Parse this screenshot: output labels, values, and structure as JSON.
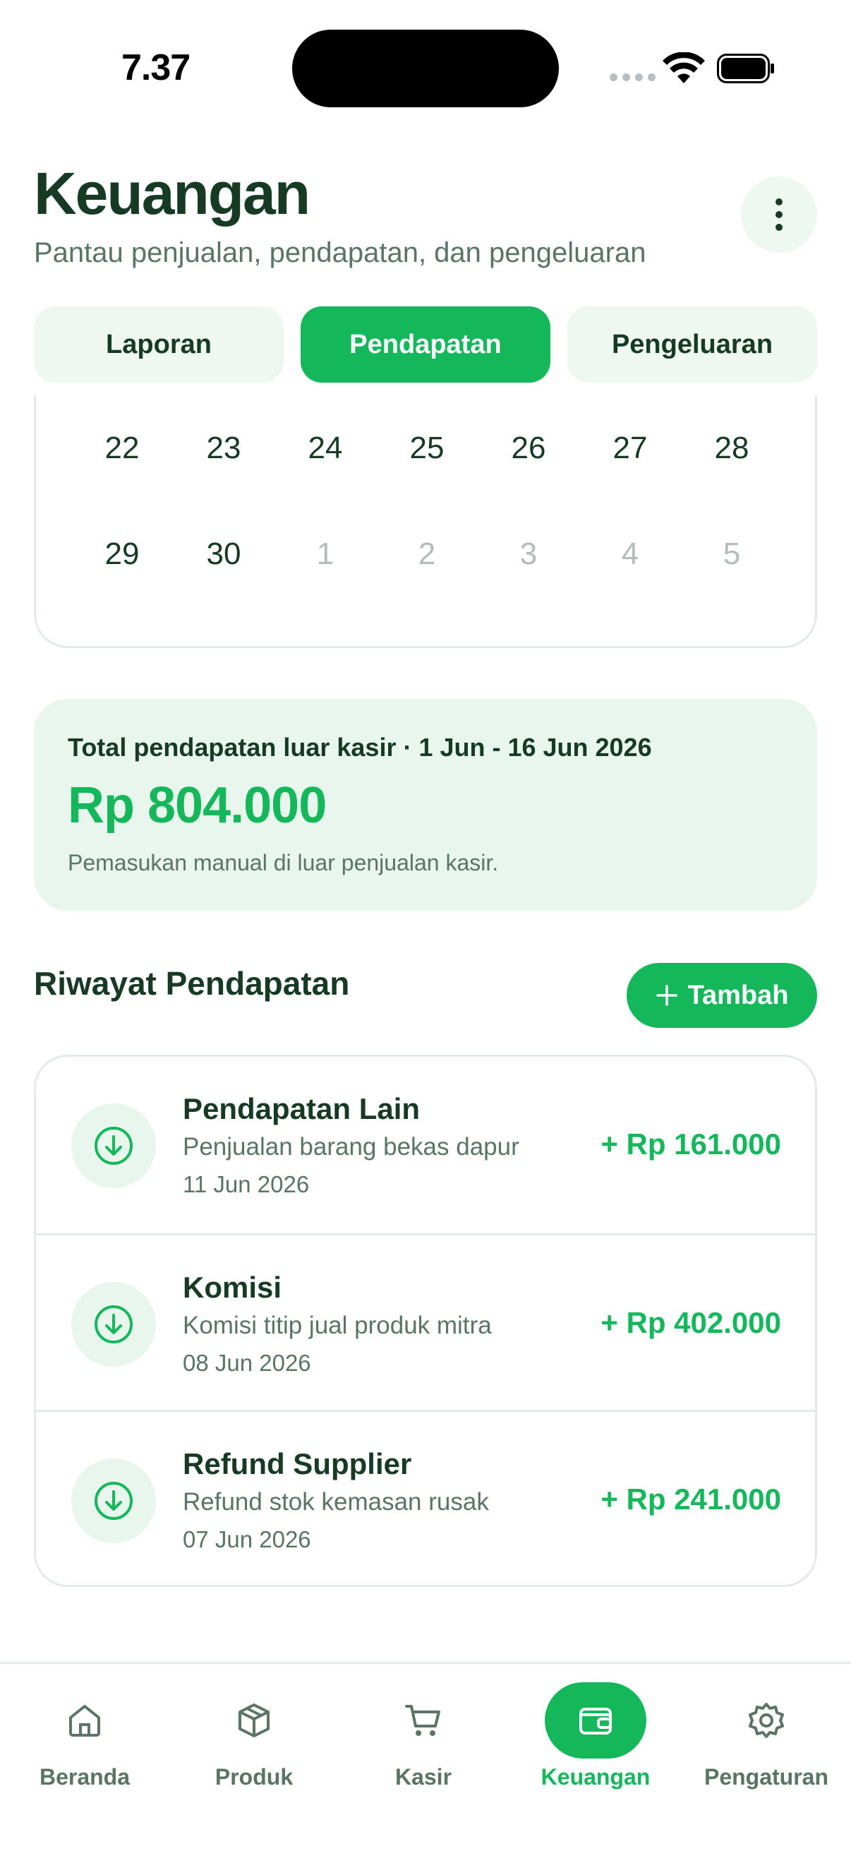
{
  "status_bar": {
    "time": "7.37"
  },
  "header": {
    "title": "Keuangan",
    "subtitle": "Pantau penjualan, pendapatan, dan pengeluaran"
  },
  "tabs": [
    {
      "label": "Laporan",
      "active": false
    },
    {
      "label": "Pendapatan",
      "active": true
    },
    {
      "label": "Pengeluaran",
      "active": false
    }
  ],
  "calendar": {
    "rows": [
      [
        {
          "day": "22",
          "muted": false
        },
        {
          "day": "23",
          "muted": false
        },
        {
          "day": "24",
          "muted": false
        },
        {
          "day": "25",
          "muted": false
        },
        {
          "day": "26",
          "muted": false
        },
        {
          "day": "27",
          "muted": false
        },
        {
          "day": "28",
          "muted": false
        }
      ],
      [
        {
          "day": "29",
          "muted": false
        },
        {
          "day": "30",
          "muted": false
        },
        {
          "day": "1",
          "muted": true
        },
        {
          "day": "2",
          "muted": true
        },
        {
          "day": "3",
          "muted": true
        },
        {
          "day": "4",
          "muted": true
        },
        {
          "day": "5",
          "muted": true
        }
      ]
    ]
  },
  "summary": {
    "label": "Total pendapatan luar kasir · 1 Jun - 16 Jun 2026",
    "amount": "Rp 804.000",
    "note": "Pemasukan manual di luar penjualan kasir."
  },
  "history": {
    "title": "Riwayat Pendapatan",
    "add_label": "Tambah",
    "items": [
      {
        "title": "Pendapatan Lain",
        "description": "Penjualan barang bekas dapur",
        "date": "11 Jun 2026",
        "amount": "+ Rp 161.000"
      },
      {
        "title": "Komisi",
        "description": "Komisi titip jual produk mitra",
        "date": "08 Jun 2026",
        "amount": "+ Rp 402.000"
      },
      {
        "title": "Refund Supplier",
        "description": "Refund stok kemasan rusak",
        "date": "07 Jun 2026",
        "amount": "+ Rp 241.000"
      }
    ]
  },
  "bottom_nav": [
    {
      "label": "Beranda",
      "icon": "home-icon",
      "active": false
    },
    {
      "label": "Produk",
      "icon": "box-icon",
      "active": false
    },
    {
      "label": "Kasir",
      "icon": "cart-icon",
      "active": false
    },
    {
      "label": "Keuangan",
      "icon": "wallet-icon",
      "active": true
    },
    {
      "label": "Pengaturan",
      "icon": "gear-icon",
      "active": false
    }
  ],
  "colors": {
    "accent": "#14b85a",
    "text_dark": "#163a24",
    "text_muted": "#5a7465",
    "tint": "#e8f6ed"
  }
}
